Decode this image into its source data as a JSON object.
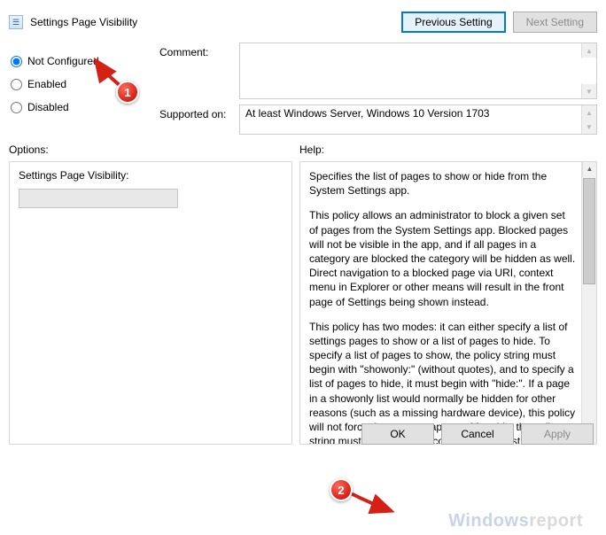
{
  "window": {
    "title": "Settings Page Visibility"
  },
  "nav": {
    "prev": "Previous Setting",
    "next": "Next Setting"
  },
  "radios": {
    "not_configured": "Not Configured",
    "enabled": "Enabled",
    "disabled": "Disabled",
    "selected": "not_configured"
  },
  "fields": {
    "comment_label": "Comment:",
    "comment_value": "",
    "supported_label": "Supported on:",
    "supported_value": "At least Windows Server, Windows 10 Version 1703"
  },
  "options": {
    "heading": "Options:",
    "item_label": "Settings Page Visibility:",
    "item_value": ""
  },
  "help": {
    "heading": "Help:",
    "p1": "Specifies the list of pages to show or hide from the System Settings app.",
    "p2": "This policy allows an administrator to block a given set of pages from the System Settings app. Blocked pages will not be visible in the app, and if all pages in a category are blocked the category will be hidden as well. Direct navigation to a blocked page via URI, context menu in Explorer or other means will result in the front page of Settings being shown instead.",
    "p3": "This policy has two modes: it can either specify a list of settings pages to show or a list of pages to hide. To specify a list of pages to show, the policy string must begin with \"showonly:\" (without quotes), and to specify a list of pages to hide, it must begin with \"hide:\". If a page in a showonly list would normally be hidden for other reasons (such as a missing hardware device), this policy will not force that page to appear. After this, the policy string must contain a semicolon-delimited list of settings page identifiers. The identifier for any given settings page is the published URI for that page, minus the \"ms-settings:\" protocol part."
  },
  "footer": {
    "ok": "OK",
    "cancel": "Cancel",
    "apply": "Apply"
  },
  "annotations": {
    "callout1": "1",
    "callout2": "2"
  },
  "watermark": {
    "w": "W",
    "rest1": "indows",
    "rest2": "report"
  }
}
